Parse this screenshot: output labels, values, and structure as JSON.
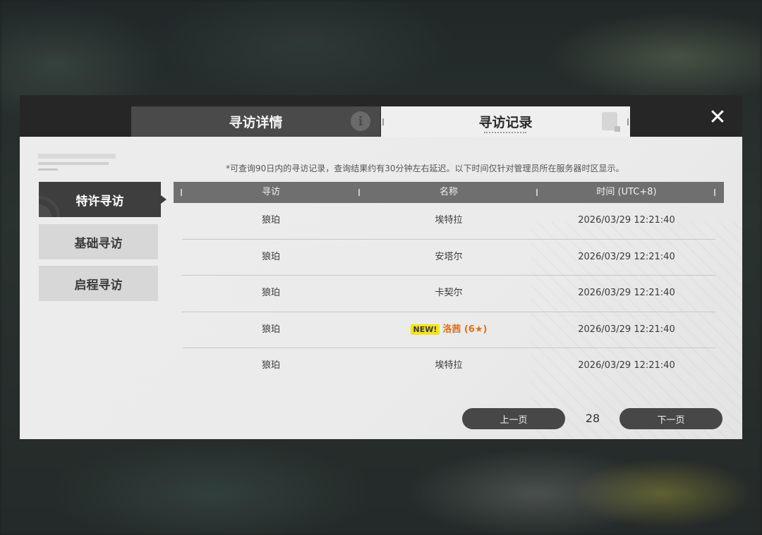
{
  "tabs": {
    "details_label": "寻访详情",
    "records_label": "寻访记录"
  },
  "icons": {
    "info": "info-icon",
    "records": "document-icon",
    "close": "close-icon"
  },
  "sidebar": {
    "items": [
      {
        "label": "特许寻访",
        "active": true
      },
      {
        "label": "基础寻访",
        "active": false
      },
      {
        "label": "启程寻访",
        "active": false
      }
    ]
  },
  "notice": "*可查询90日内的寻访记录，查询结果约有30分钟左右延迟。以下时间仅针对管理员所在服务器时区显示。",
  "table": {
    "columns": [
      "寻访",
      "名称",
      "时间 (UTC+8)"
    ],
    "rows": [
      {
        "pool": "狼珀",
        "name": "埃特拉",
        "time": "2026/03/29 12:21:40"
      },
      {
        "pool": "狼珀",
        "name": "安塔尔",
        "time": "2026/03/29 12:21:40"
      },
      {
        "pool": "狼珀",
        "name": "卡契尔",
        "time": "2026/03/29 12:21:40"
      },
      {
        "pool": "狼珀",
        "name": "洛茜 (6★)",
        "badge": "NEW!",
        "time": "2026/03/29 12:21:40"
      },
      {
        "pool": "狼珀",
        "name": "埃特拉",
        "time": "2026/03/29 12:21:40"
      }
    ]
  },
  "pagination": {
    "prev_label": "上一页",
    "page": "28",
    "next_label": "下一页"
  },
  "colors": {
    "highlight": "#e0701a",
    "badge": "#f3e41b",
    "header": "#262626"
  }
}
